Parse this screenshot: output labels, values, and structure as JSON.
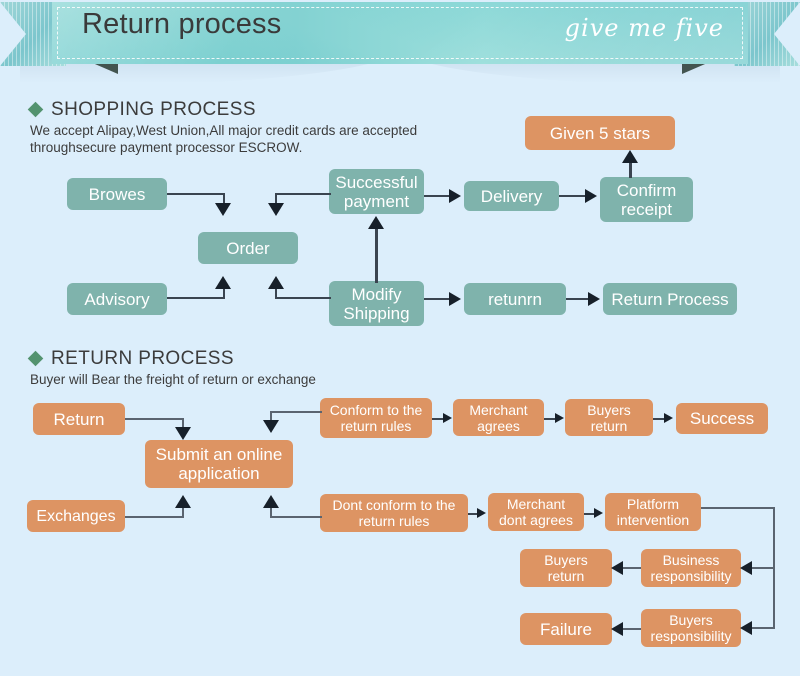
{
  "header": {
    "title": "Return process",
    "script_text": "give me five"
  },
  "shopping": {
    "heading": "SHOPPING PROCESS",
    "description": "We accept Alipay,West Union,All major credit cards are accepted\nthroughsecure payment processor ESCROW.",
    "boxes": {
      "browes": "Browes",
      "order": "Order",
      "advisory": "Advisory",
      "successful_payment": "Successful\npayment",
      "modify_shipping": "Modify\nShipping",
      "delivery": "Delivery",
      "confirm_receipt": "Confirm\nreceipt",
      "given_5_stars": "Given 5 stars",
      "retunrn": "retunrn",
      "return_process": "Return Process"
    }
  },
  "returns": {
    "heading": "RETURN PROCESS",
    "description": "Buyer will Bear the freight of return or exchange",
    "boxes": {
      "return": "Return",
      "exchanges": "Exchanges",
      "submit_online_application": "Submit an online\napplication",
      "conform_rules": "Conform to the\nreturn rules",
      "merchant_agrees": "Merchant\nagrees",
      "buyers_return_top": "Buyers\nreturn",
      "success": "Success",
      "dont_conform_rules": "Dont conform to the\nreturn rules",
      "merchant_dont_agrees": "Merchant\ndont agrees",
      "platform_intervention": "Platform\nintervention",
      "business_responsibility": "Business\nresponsibility",
      "buyers_return_bottom": "Buyers\nreturn",
      "buyers_responsibility": "Buyers\nresponsibility",
      "failure": "Failure"
    }
  },
  "colors": {
    "background": "#dceefb",
    "teal_box": "#7fb3ac",
    "orange_box": "#dd9463",
    "banner_teal": "#8ed6d4",
    "diamond_green": "#53936f",
    "connector": "#3a4450"
  }
}
